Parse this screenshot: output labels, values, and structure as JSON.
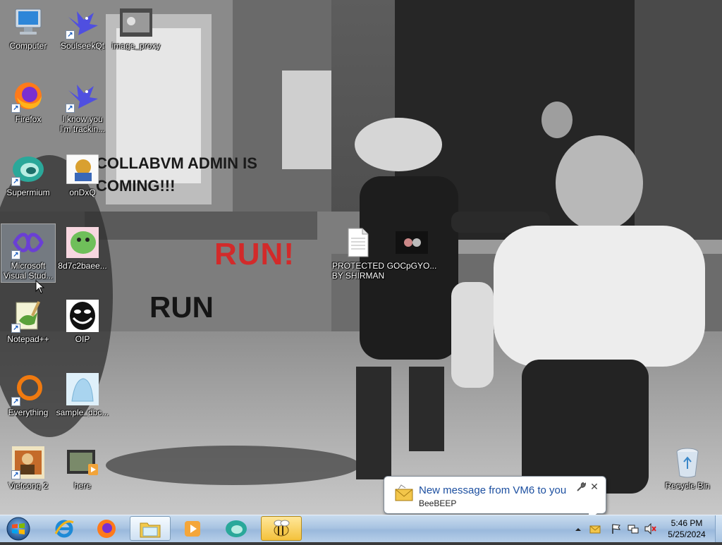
{
  "desktop": {
    "icons": [
      {
        "name": "computer",
        "label": "Computer"
      },
      {
        "name": "soulseekqt",
        "label": "SoulseekQt"
      },
      {
        "name": "image-proxy",
        "label": "image_proxy"
      },
      {
        "name": "firefox",
        "label": "Firefox"
      },
      {
        "name": "i-know-you",
        "label": "I know you I'm trackin..."
      },
      {
        "name": "supermium",
        "label": "Supermium"
      },
      {
        "name": "ondxq",
        "label": "onDxQ"
      },
      {
        "name": "visual-studio",
        "label": "Microsoft Visual Stud..."
      },
      {
        "name": "8d7c2baee",
        "label": "8d7c2baee..."
      },
      {
        "name": "notepadpp",
        "label": "Notepad++"
      },
      {
        "name": "oip",
        "label": "OIP"
      },
      {
        "name": "everything",
        "label": "Everything"
      },
      {
        "name": "sample-dbc",
        "label": "sample_dbc..."
      },
      {
        "name": "vietcong2",
        "label": "Vietcong 2"
      },
      {
        "name": "here",
        "label": "here"
      },
      {
        "name": "protected",
        "label": "PROTECTED BY SHIRMAN"
      },
      {
        "name": "gocpgyo",
        "label": "GOCpGYO..."
      },
      {
        "name": "recycle-bin",
        "label": "Recycle Bin"
      }
    ]
  },
  "wallpaper": {
    "collab_text": "COLLABVM ADMIN IS COMING!!!",
    "run_red": "RUN!",
    "run_black": "RUN"
  },
  "notification": {
    "title": "New message from VM6 to you",
    "app": "BeeBEEP",
    "close": "✕"
  },
  "taskbar": {
    "pinned": [
      "Internet Explorer",
      "Firefox",
      "Windows Explorer",
      "Media Player",
      "Supermium",
      "BeeBEEP"
    ],
    "clock_time": "5:46 PM",
    "clock_date": "5/25/2024"
  },
  "colors": {
    "run_red": "#d22a2a",
    "taskbar": "#a9c4e2",
    "notify_title": "#1c4fa0"
  }
}
